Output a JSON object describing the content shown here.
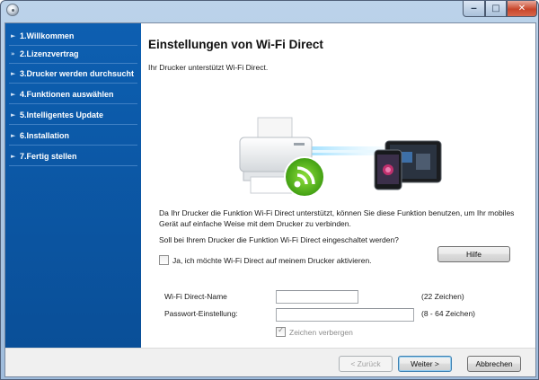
{
  "window": {
    "title": "",
    "controls": {
      "minimize": "‒",
      "maximize": "□",
      "close": "✕"
    }
  },
  "sidebar": {
    "items": [
      {
        "label": "1.Willkommen",
        "state": "done"
      },
      {
        "label": "2.Lizenzvertrag",
        "state": "current"
      },
      {
        "label": "3.Drucker werden durchsucht",
        "state": "pending"
      },
      {
        "label": "4.Funktionen auswählen",
        "state": "pending"
      },
      {
        "label": "5.Intelligentes Update",
        "state": "pending"
      },
      {
        "label": "6.Installation",
        "state": "pending"
      },
      {
        "label": "7.Fertig stellen",
        "state": "pending"
      }
    ],
    "arrow_glyph": "►",
    "current_arrow_glyph": "»",
    "accent_color": "#0d5fb1"
  },
  "main": {
    "title": "Einstellungen von Wi-Fi Direct",
    "intro": "Ihr Drucker unterstützt Wi-Fi Direct.",
    "description": "Da Ihr Drucker die Funktion Wi-Fi Direct unterstützt, können Sie diese Funktion benutzen, um Ihr mobiles Gerät auf einfache Weise mit dem Drucker zu verbinden.",
    "question": "Soll bei Ihrem Drucker die Funktion Wi-Fi Direct eingeschaltet werden?",
    "help_button": "Hilfe",
    "enable_checkbox": {
      "label": "Ja, ich möchte Wi-Fi Direct auf meinem Drucker aktivieren.",
      "checked": false
    },
    "fields": {
      "name": {
        "label": "Wi-Fi Direct-Name",
        "value": "",
        "hint": "(22 Zeichen)"
      },
      "password": {
        "label": "Passwort-Einstellung:",
        "value": "",
        "hint": "(8 - 64 Zeichen)"
      }
    },
    "hide_chars_checkbox": {
      "label": "Zeichen verbergen",
      "checked": true,
      "enabled": false
    },
    "illustration_icons": [
      "printer-icon",
      "wifi-icon",
      "smartphone-icon",
      "tablet-icon"
    ]
  },
  "footer": {
    "back_button": "< Zurück",
    "next_button": "Weiter >",
    "cancel_button": "Abbrechen"
  }
}
